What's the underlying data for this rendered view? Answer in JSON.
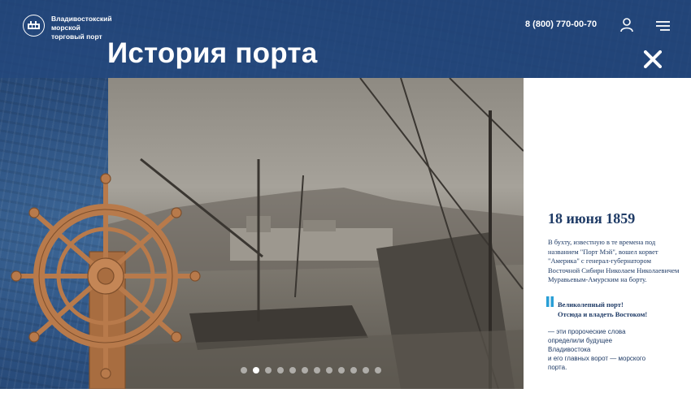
{
  "header": {
    "logo_lines": [
      "Владивостокский",
      "морской",
      "торговый порт"
    ],
    "logo_icon": "port-emblem-icon",
    "phone": "8 (800) 770-00-70",
    "user_icon": "user-icon",
    "menu_icon": "hamburger-menu-icon"
  },
  "page": {
    "title": "История порта",
    "close_icon": "close-icon"
  },
  "event": {
    "date": "18 июня 1859",
    "description": "В бухту, известную в те времена под названием \"Порт Мэй\", вошел корвет \"Америка\" с генерал-губернатором Восточной Сибири Николаем Николаевичем Муравьевым-Амурским на борту.",
    "quote_lines": [
      "Великолепный порт!",
      "Отсюда и владеть Востоком!"
    ],
    "after_lines": [
      "— эти пророческие слова",
      "определили будущее",
      "Владивостока",
      "и его главных ворот — морского",
      "порта."
    ]
  },
  "slider": {
    "total": 12,
    "active_index": 1
  },
  "colors": {
    "header_bg": "#24487d",
    "text_dark": "#1f3b66",
    "quote_accent": "#2a9fd6",
    "wheel": "#b87a4b"
  }
}
